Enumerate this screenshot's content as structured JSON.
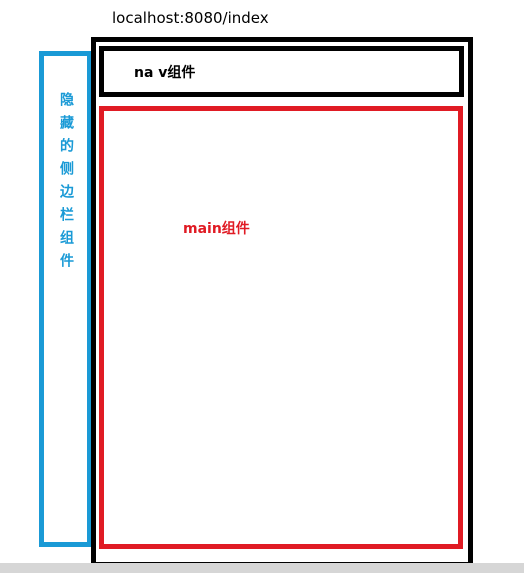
{
  "url": "localhost:8080/index",
  "nav": {
    "label": "na v组件"
  },
  "main": {
    "label": "main组件"
  },
  "sidebar": {
    "label": "隐藏的侧边栏组件"
  },
  "colors": {
    "frame": "#000000",
    "main_border": "#e01b24",
    "sidebar_border": "#1a9ad6",
    "bottom_bar": "#d6d6d6"
  }
}
